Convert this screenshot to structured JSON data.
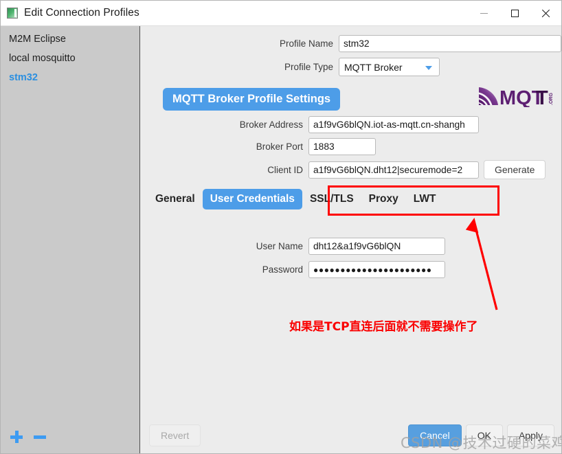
{
  "window": {
    "title": "Edit Connection Profiles",
    "icon": "app-icon",
    "controls": {
      "minimize": "minimize-icon",
      "maximize": "maximize-icon",
      "close": "close-icon"
    }
  },
  "sidebar": {
    "items": [
      {
        "label": "M2M Eclipse",
        "selected": false
      },
      {
        "label": "local mosquitto",
        "selected": false
      },
      {
        "label": "stm32",
        "selected": true
      }
    ],
    "add_label": "+",
    "remove_label": "–"
  },
  "form": {
    "profile_name_label": "Profile Name",
    "profile_name_value": "stm32",
    "profile_type_label": "Profile Type",
    "profile_type_value": "MQTT Broker",
    "logo_text": "MQTT",
    "logo_suffix": ".ORG"
  },
  "section": {
    "title": "MQTT Broker Profile Settings"
  },
  "broker": {
    "address_label": "Broker Address",
    "address_value": "a1f9vG6blQN.iot-as-mqtt.cn-shangh",
    "port_label": "Broker Port",
    "port_value": "1883",
    "client_id_label": "Client ID",
    "client_id_value": "a1f9vG6blQN.dht12|securemode=2",
    "generate_label": "Generate"
  },
  "tabs": [
    {
      "label": "General",
      "active": false
    },
    {
      "label": "User Credentials",
      "active": true
    },
    {
      "label": "SSL/TLS",
      "active": false
    },
    {
      "label": "Proxy",
      "active": false
    },
    {
      "label": "LWT",
      "active": false
    }
  ],
  "credentials": {
    "user_name_label": "User Name",
    "user_name_value": "dht12&a1f9vG6blQN",
    "password_label": "Password",
    "password_value": "●●●●●●●●●●●●●●●●●●●●●●"
  },
  "annotation": {
    "text": "如果是TCP直连后面就不需要操作了",
    "color": "#fa0000",
    "highlight_color": "#ff0000"
  },
  "footer": {
    "revert_label": "Revert",
    "cancel_label": "Cancel",
    "ok_label": "OK",
    "apply_label": "Apply"
  },
  "watermark": {
    "text": "CSDN @技术过硬的菜鸡"
  },
  "colors": {
    "accent": "#4d9de8",
    "selected_item": "#2b8fe0",
    "annotation_red": "#ff0000",
    "sidebar_bg": "#cacaca",
    "panel_bg": "#ececec"
  }
}
